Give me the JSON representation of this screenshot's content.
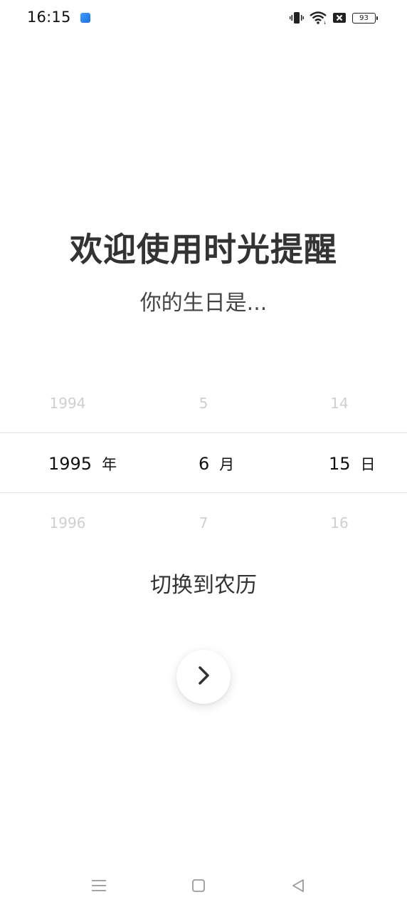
{
  "status_bar": {
    "time": "16:15",
    "battery": "93",
    "icons": [
      "app-notification-icon",
      "vibrate-icon",
      "wifi-icon",
      "sim-disabled-icon",
      "battery-icon"
    ]
  },
  "header": {
    "title": "欢迎使用时光提醒",
    "subtitle": "你的生日是..."
  },
  "picker": {
    "year": {
      "prev": "1994",
      "selected": "1995",
      "unit": "年",
      "next": "1996"
    },
    "month": {
      "prev": "5",
      "selected": "6",
      "unit": "月",
      "next": "7"
    },
    "day": {
      "prev": "14",
      "selected": "15",
      "unit": "日",
      "next": "16"
    }
  },
  "actions": {
    "switch_calendar_label": "切换到农历",
    "next_icon": "chevron-right-icon"
  },
  "nav_bar": {
    "icons": [
      "menu-icon",
      "home-icon",
      "back-icon"
    ]
  },
  "colors": {
    "title": "#333333",
    "dim_text": "#cfcfcf",
    "divider": "#e2e2e2",
    "app_icon": "#1a6fe6"
  }
}
